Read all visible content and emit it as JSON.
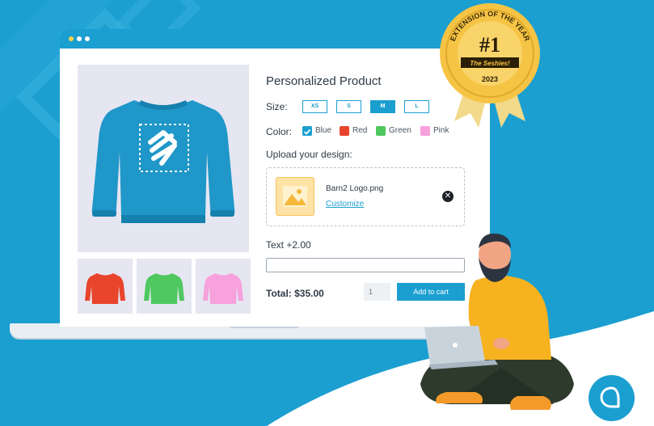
{
  "product": {
    "title": "Personalized Product",
    "size_label": "Size:",
    "sizes": [
      "XS",
      "S",
      "M",
      "L"
    ],
    "selected_size": "M",
    "color_label": "Color:",
    "colors": [
      {
        "name": "Blue",
        "hex": "#1b9fd0",
        "checked": true
      },
      {
        "name": "Red",
        "hex": "#e8452c",
        "checked": false
      },
      {
        "name": "Green",
        "hex": "#4fc85f",
        "checked": false
      },
      {
        "name": "Pink",
        "hex": "#f7a1dd",
        "checked": false
      }
    ],
    "upload_label": "Upload your design:",
    "file_name": "Barn2 Logo.png",
    "customize_link": "Customize",
    "text_label": "Text +2.00",
    "text_value": "",
    "total": "Total: $35.00",
    "quantity": "1",
    "add_to_cart": "Add to cart"
  },
  "badge": {
    "arc_text": "EXTENSION OF THE YEAR",
    "rank": "#1",
    "award": "The Seshies!",
    "year": "2023"
  },
  "colors": {
    "brand_blue": "#1b9fd0",
    "sweater_blue": "#1f97c8",
    "sweater_red": "#e8452c",
    "sweater_green": "#4fc85f",
    "sweater_pink": "#f7a1dd",
    "gold": "#f6c445"
  }
}
